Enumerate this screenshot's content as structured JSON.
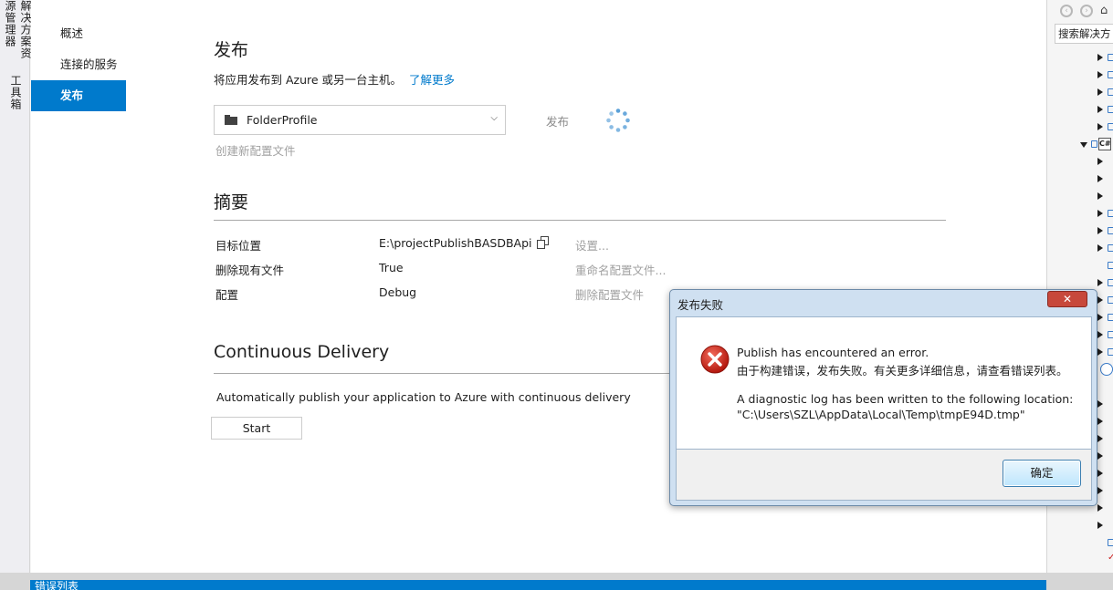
{
  "left_strip": {
    "tab1": "解决方案资源管理器",
    "tab2": "工具箱"
  },
  "nav": {
    "items": [
      {
        "label": "概述"
      },
      {
        "label": "连接的服务"
      },
      {
        "label": "发布"
      }
    ],
    "active_index": 2
  },
  "publish": {
    "title": "发布",
    "description": "将应用发布到 Azure 或另一台主机。",
    "learn_more": "了解更多",
    "profile": "FolderProfile",
    "publish_button": "发布",
    "create_profile": "创建新配置文件"
  },
  "summary": {
    "title": "摘要",
    "rows": [
      {
        "key": "目标位置",
        "value": "E:\\projectPublishBASDBApi",
        "action": "设置..."
      },
      {
        "key": "删除现有文件",
        "value": "True",
        "action": "重命名配置文件..."
      },
      {
        "key": "配置",
        "value": "Debug",
        "action": "删除配置文件"
      }
    ]
  },
  "continuous_delivery": {
    "title": "Continuous Delivery",
    "description": "Automatically publish your application to Azure with continuous delivery",
    "start_button": "Start"
  },
  "solution_explorer": {
    "search_placeholder": "搜索解决方"
  },
  "bottom_bar": {
    "label": "错误列表"
  },
  "dialog": {
    "title": "发布失败",
    "close_label": "✕",
    "line1": "Publish has encountered an error.",
    "line2": "由于构建错误，发布失败。有关更多详细信息，请查看错误列表。",
    "line3": "A diagnostic log has been written to the following location:",
    "line4": "\"C:\\Users\\SZL\\AppData\\Local\\Temp\\tmpE94D.tmp\"",
    "ok_button": "确定"
  },
  "colors": {
    "accent": "#007acc",
    "error_red": "#c62828",
    "dialog_frame": "#cfe0f1"
  }
}
